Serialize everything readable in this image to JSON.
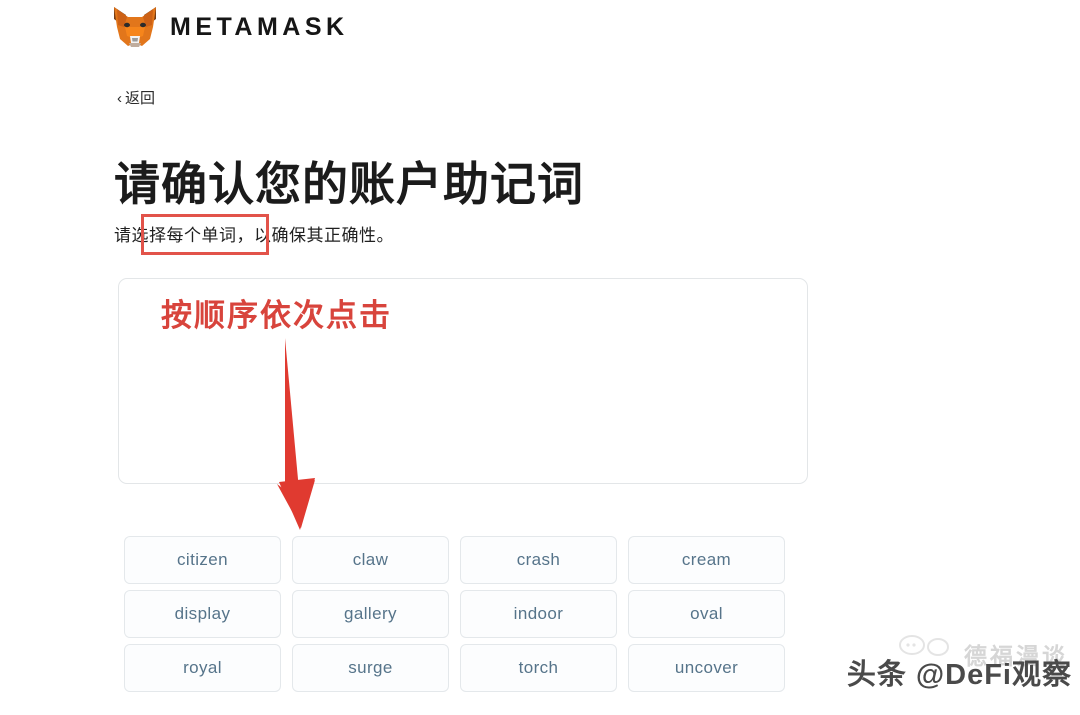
{
  "brand": {
    "logo_icon": "metamask-fox-icon",
    "wordmark": "METAMASK"
  },
  "nav": {
    "back_chevron": "‹",
    "back_label": "返回"
  },
  "page": {
    "title": "请确认您的账户助记词",
    "subtitle": "请选择每个单词，以确保其正确性。"
  },
  "annotations": {
    "highlight_box_color": "#e2534a",
    "arrow_color": "#e03a30",
    "instruction_text": "按顺序依次点击",
    "instruction_color": "#d8443c"
  },
  "confirm_box": {
    "selected_words": []
  },
  "word_bank": {
    "words": [
      "citizen",
      "claw",
      "crash",
      "cream",
      "display",
      "gallery",
      "indoor",
      "oval",
      "royal",
      "surge",
      "torch",
      "uncover"
    ],
    "text_color": "#56748a"
  },
  "watermark": {
    "back_text": "德福漫谈",
    "front_text": "头条 @DeFi观察"
  }
}
